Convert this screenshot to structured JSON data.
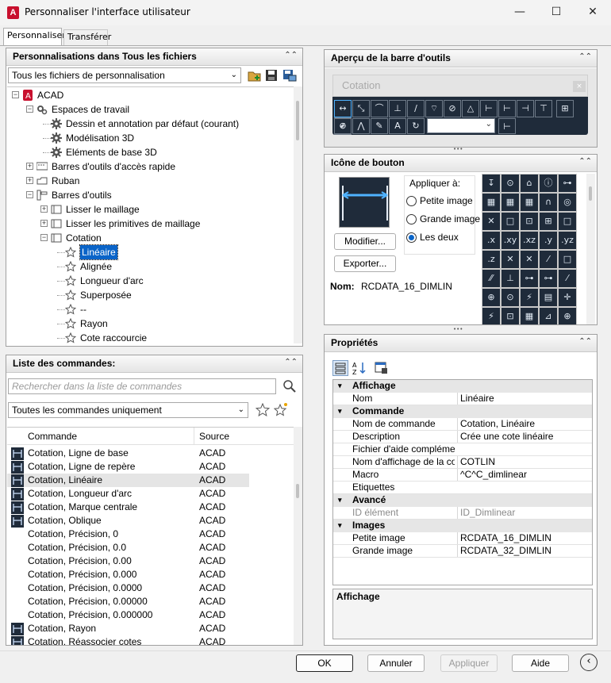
{
  "window": {
    "title": "Personnaliser l'interface utilisateur",
    "logo_letter": "A"
  },
  "tabs": [
    {
      "label": "Personnaliser"
    },
    {
      "label": "Transférer"
    }
  ],
  "customizations": {
    "header": "Personnalisations dans Tous les fichiers",
    "file_select": "Tous les fichiers de personnalisation",
    "tree": [
      {
        "label": "ACAD",
        "depth": 0,
        "expander": "−",
        "icon": "acad-icon"
      },
      {
        "label": "Espaces de travail",
        "depth": 1,
        "expander": "−",
        "icon": "workspace-icon"
      },
      {
        "label": "Dessin et annotation par défaut (courant)",
        "depth": 2,
        "expander": "",
        "icon": "gear-icon"
      },
      {
        "label": "Modélisation 3D",
        "depth": 2,
        "expander": "",
        "icon": "gear-icon"
      },
      {
        "label": "Eléments de base 3D",
        "depth": 2,
        "expander": "",
        "icon": "gear-icon"
      },
      {
        "label": "Barres d'outils d'accès rapide",
        "depth": 1,
        "expander": "+",
        "icon": "quick-access-icon"
      },
      {
        "label": "Ruban",
        "depth": 1,
        "expander": "+",
        "icon": "ribbon-icon"
      },
      {
        "label": "Barres d'outils",
        "depth": 1,
        "expander": "−",
        "icon": "toolbars-icon"
      },
      {
        "label": "Lisser le maillage",
        "depth": 2,
        "expander": "+",
        "icon": "toolbar-icon"
      },
      {
        "label": "Lisser les primitives de maillage",
        "depth": 2,
        "expander": "+",
        "icon": "toolbar-icon"
      },
      {
        "label": "Cotation",
        "depth": 2,
        "expander": "−",
        "icon": "toolbar-icon"
      },
      {
        "label": "Linéaire",
        "depth": 3,
        "expander": "",
        "icon": "star-icon",
        "selected": true
      },
      {
        "label": "Alignée",
        "depth": 3,
        "expander": "",
        "icon": "star-icon"
      },
      {
        "label": "Longueur d'arc",
        "depth": 3,
        "expander": "",
        "icon": "star-icon"
      },
      {
        "label": "Superposée",
        "depth": 3,
        "expander": "",
        "icon": "star-icon"
      },
      {
        "label": "--",
        "depth": 3,
        "expander": "",
        "icon": "star-icon"
      },
      {
        "label": "Rayon",
        "depth": 3,
        "expander": "",
        "icon": "star-icon"
      },
      {
        "label": "Cote raccourcie",
        "depth": 3,
        "expander": "",
        "icon": "star-icon"
      }
    ]
  },
  "commands": {
    "header": "Liste des commandes:",
    "search_placeholder": "Rechercher dans la liste de commandes",
    "filter": "Toutes les commandes uniquement",
    "columns": {
      "command": "Commande",
      "source": "Source"
    },
    "rows": [
      {
        "name": "Cotation, Ligne de base",
        "source": "ACAD",
        "icon": true
      },
      {
        "name": "Cotation, Ligne de repère",
        "source": "ACAD",
        "icon": true
      },
      {
        "name": "Cotation, Linéaire",
        "source": "ACAD",
        "icon": true,
        "highlight": true
      },
      {
        "name": "Cotation, Longueur d'arc",
        "source": "ACAD",
        "icon": true
      },
      {
        "name": "Cotation, Marque centrale",
        "source": "ACAD",
        "icon": true
      },
      {
        "name": "Cotation, Oblique",
        "source": "ACAD",
        "icon": true
      },
      {
        "name": "Cotation, Précision, 0",
        "source": "ACAD",
        "icon": false
      },
      {
        "name": "Cotation, Précision, 0.0",
        "source": "ACAD",
        "icon": false
      },
      {
        "name": "Cotation, Précision, 0.00",
        "source": "ACAD",
        "icon": false
      },
      {
        "name": "Cotation, Précision, 0.000",
        "source": "ACAD",
        "icon": false
      },
      {
        "name": "Cotation, Précision, 0.0000",
        "source": "ACAD",
        "icon": false
      },
      {
        "name": "Cotation, Précision, 0.00000",
        "source": "ACAD",
        "icon": false
      },
      {
        "name": "Cotation, Précision, 0.000000",
        "source": "ACAD",
        "icon": false
      },
      {
        "name": "Cotation, Rayon",
        "source": "ACAD",
        "icon": true
      },
      {
        "name": "Cotation, Réassocier cotes",
        "source": "ACAD",
        "icon": true
      }
    ]
  },
  "toolbar_preview": {
    "header": "Aperçu de la barre d'outils",
    "toolbar_title": "Cotation"
  },
  "button_image": {
    "header": "Icône de bouton",
    "apply_label": "Appliquer à:",
    "options": [
      {
        "label": "Petite image",
        "checked": false
      },
      {
        "label": "Grande image",
        "checked": false
      },
      {
        "label": "Les deux",
        "checked": true
      }
    ],
    "modify": "Modifier...",
    "export": "Exporter...",
    "name_label": "Nom:",
    "name_value": "RCDATA_16_DIMLIN"
  },
  "properties": {
    "header": "Propriétés",
    "sections": [
      {
        "title": "Affichage",
        "rows": [
          {
            "k": "Nom",
            "v": "Linéaire"
          }
        ]
      },
      {
        "title": "Commande",
        "rows": [
          {
            "k": "Nom de commande",
            "v": "Cotation, Linéaire"
          },
          {
            "k": "Description",
            "v": "Crée une cote linéaire"
          },
          {
            "k": "Fichier d'aide complémen",
            "v": ""
          },
          {
            "k": "Nom d'affichage de la con",
            "v": "COTLIN"
          },
          {
            "k": "Macro",
            "v": "^C^C_dimlinear"
          },
          {
            "k": "Etiquettes",
            "v": ""
          }
        ]
      },
      {
        "title": "Avancé",
        "rows": [
          {
            "k": "ID élément",
            "v": "ID_Dimlinear",
            "disabled": true
          }
        ]
      },
      {
        "title": "Images",
        "rows": [
          {
            "k": "Petite image",
            "v": "RCDATA_16_DIMLIN"
          },
          {
            "k": "Grande image",
            "v": "RCDATA_32_DIMLIN"
          }
        ]
      }
    ],
    "description_title": "Affichage"
  },
  "footer": {
    "ok": "OK",
    "cancel": "Annuler",
    "apply": "Appliquer",
    "help": "Aide"
  }
}
